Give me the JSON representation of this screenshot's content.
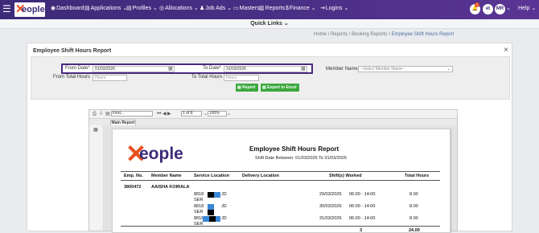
{
  "nav": {
    "items": [
      {
        "label": "Dashboard",
        "icon": "dashboard-icon"
      },
      {
        "label": "Applications",
        "icon": "applications-icon"
      },
      {
        "label": "Profiles",
        "icon": "profiles-icon"
      },
      {
        "label": "Allocations",
        "icon": "allocations-icon"
      },
      {
        "label": "Job Ads",
        "icon": "job-ads-icon"
      },
      {
        "label": "Masters",
        "icon": "masters-icon"
      },
      {
        "label": "Reports",
        "icon": "reports-icon"
      },
      {
        "label": "Finance",
        "icon": "finance-icon"
      },
      {
        "label": "Logins",
        "icon": "logins-icon"
      }
    ],
    "notification_count": "2",
    "avatar1": "et",
    "avatar2": "MR",
    "help": "Help"
  },
  "logo": {
    "text": "eople"
  },
  "quick_links": "Quick Links",
  "breadcrumb": {
    "parts": [
      "Home",
      "Reports",
      "Booking Reports"
    ],
    "current": "Employee Shift Hours Report"
  },
  "panel": {
    "title": "Employee Shift Hours Report",
    "close": "×"
  },
  "filters": {
    "from_date_label": "From Date*",
    "from_date_value": "01/03/2026",
    "to_date_label": "To Date*",
    "to_date_value": "31/03/2026",
    "from_hours_label": "From Total Hours",
    "from_hours_placeholder": "Hours",
    "to_hours_label": "To Total Hours",
    "to_hours_placeholder": "Hours",
    "member_label": "Member Name",
    "member_placeholder": "--Select Member Name--",
    "report_button": "Report",
    "export_button": "Export to Excel"
  },
  "viewer": {
    "find_label": "Find...",
    "page_value": "1 of 8",
    "zoom": "100%",
    "tab": "Main Report"
  },
  "report": {
    "title": "Employee Shift Hours Report",
    "subtitle": "Shift Date Between:  01/03/2026  To  31/03/2026",
    "columns": [
      "Emp. No.",
      "Member Name",
      "Service Location",
      "Delivery Location",
      "Shift(s) Worked",
      "Total Hours"
    ],
    "employee": {
      "emp_no": "3800472",
      "name": "AAISHA  KOIRALA"
    },
    "rows": [
      {
        "loc_a": "8818",
        "loc_b": "SER",
        "loc_c": "JD",
        "date": "29/03/2026",
        "time": "06:00 - 14:00",
        "hours": "8.00"
      },
      {
        "loc_a": "8818",
        "loc_b": "SER",
        "loc_c": "JD",
        "date": "30/03/2026",
        "time": "06:00 - 14:00",
        "hours": "8.00"
      },
      {
        "loc_a": "8818",
        "loc_b": "SER",
        "loc_c": "JD",
        "date": "31/03/2026",
        "time": "06:00 - 14:00",
        "hours": "8.00"
      }
    ],
    "total_shifts": "3",
    "total_hours": "24.00"
  },
  "colors": {
    "nav": "#3c2a78",
    "accent": "#e8501e",
    "button": "#3aa83d",
    "highlight_border": "#4a2a7e"
  }
}
